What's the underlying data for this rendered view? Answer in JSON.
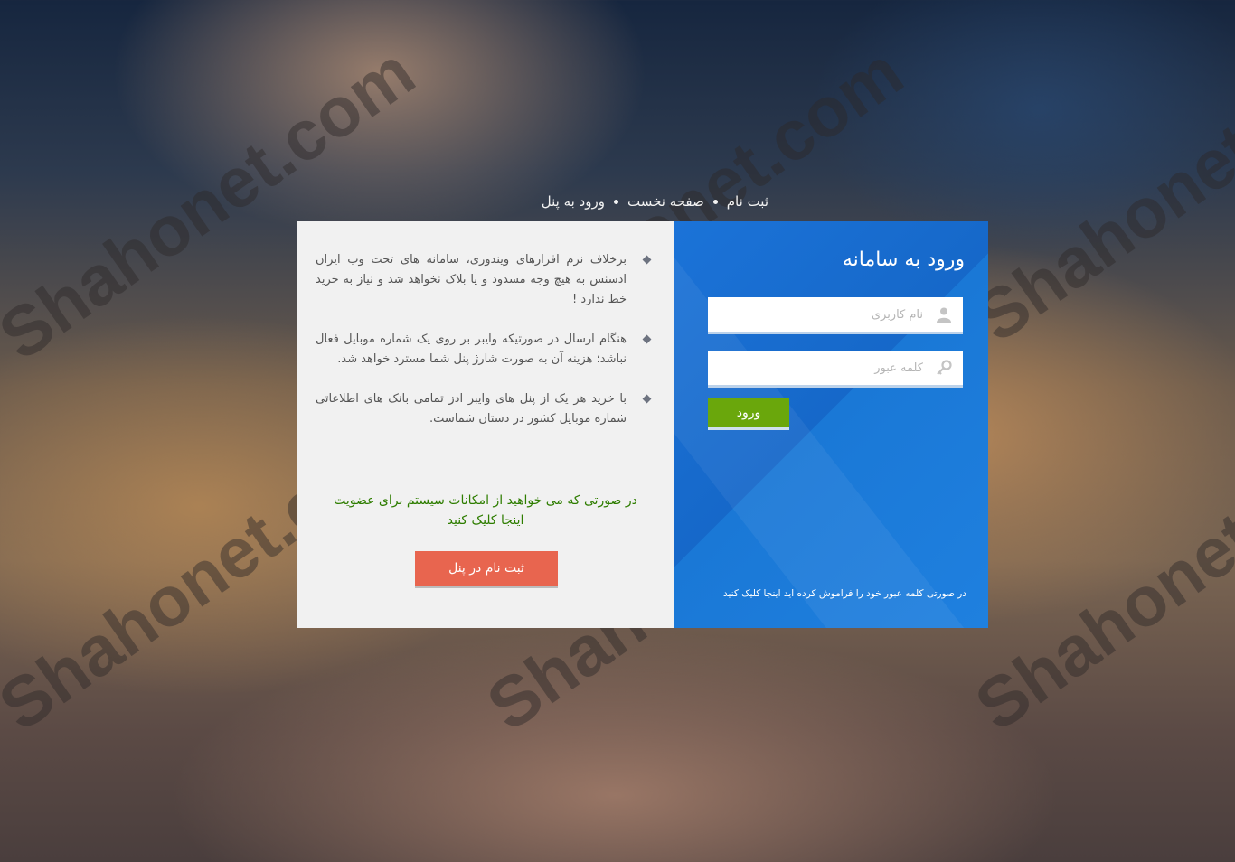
{
  "watermark": {
    "text": "Shahonet.com"
  },
  "topnav": {
    "items": [
      {
        "label": "ثبت نام"
      },
      {
        "label": "صفحه نخست"
      },
      {
        "label": "ورود به پنل"
      }
    ]
  },
  "info": {
    "bullets": [
      "برخلاف نرم افزارهای ویندوزی، سامانه های تحت وب ایران ادسنس به هیچ وجه مسدود و یا بلاک نخواهد شد و نیاز به خرید خط ندارد !",
      "هنگام ارسال در صورتیکه وایبر بر روی یک شماره موبایل فعال نباشد؛ هزینه آن به صورت شارژ پنل شما مسترد خواهد شد.",
      "با خرید هر یک از پنل های وایبر ادز تمامی بانک های اطلاعاتی شماره موبایل کشور در دستان شماست."
    ],
    "cta_text": "در صورتی که می خواهید از امکانات سیستم برای عضویت اینجا کلیک کنید",
    "register_button": "ثبت نام در پنل"
  },
  "login": {
    "title": "ورود به سامانه",
    "username_placeholder": "نام کاربری",
    "password_placeholder": "کلمه عبور",
    "submit_button": "ورود",
    "forgot_link": "در صورتی کلمه عبور خود را فراموش کرده اید اینجا کلیک کنید"
  },
  "colors": {
    "login_panel": "#1b73d8",
    "submit_button": "#6aa70c",
    "register_button": "#e8654f",
    "cta_text": "#2e7d00"
  },
  "icons": {
    "username": "user-icon",
    "password": "key-icon",
    "bullet": "diamond-bullet-icon"
  }
}
